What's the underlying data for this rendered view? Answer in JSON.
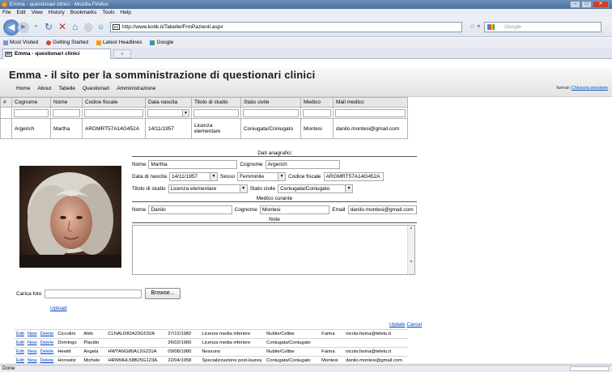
{
  "browser": {
    "window_title": "Emma - questionari clinici - Mozilla Firefox",
    "menu": [
      "File",
      "Edit",
      "View",
      "History",
      "Bookmarks",
      "Tools",
      "Help"
    ],
    "url": "http://www.kotik.it/Tabelle/FrmPazienti.aspx",
    "search_placeholder": "Google",
    "bookmarks": [
      "Most Visited",
      "Getting Started",
      "Latest Headlines",
      "Google"
    ],
    "tab_title": "Emma - questionari clinici",
    "status": "Done",
    "icons": [
      "back-arrow-icon",
      "forward-arrow-icon",
      "reload-icon",
      "stop-icon",
      "home-icon",
      "star-icon",
      "search-engine-icon"
    ]
  },
  "site": {
    "title": "Emma - il sito per la somministrazione di questionari clinici",
    "nav": [
      "Home",
      "About",
      "Tabelle",
      "Questionari",
      "Amministrazione"
    ],
    "user": "farinan",
    "logout": "Chiusura sessione"
  },
  "grid": {
    "columns": [
      "#",
      "Cognome",
      "Nome",
      "Codice fiscale",
      "Data nascita",
      "Titolo di studio",
      "Stato civile",
      "Medico",
      "Mail medico"
    ],
    "row": {
      "cognome": "Argerich",
      "nome": "Martha",
      "codice_fiscale": "ARGMRT57A14G452A",
      "data_nascita": "14/11/1957",
      "titolo_studio_1": "Licenza",
      "titolo_studio_2": "elementare",
      "stato_civile": "Coniugata/Coniugato",
      "medico": "Montesi",
      "mail_medico": "danilo.montesi@gmail.com"
    }
  },
  "detail": {
    "anagrafici_title": "Dati anagrafici",
    "labels": {
      "nome": "Nome",
      "cognome": "Cognome",
      "data_nascita": "Data di nascita",
      "sesso": "Sesso",
      "codice_fiscale": "Codice fiscale",
      "titolo_studio": "Titolo di studio",
      "stato_civile": "Stato civile",
      "email": "Email"
    },
    "values": {
      "nome": "Martha",
      "cognome": "Argerich",
      "data_nascita": "14/11/1957",
      "sesso": "Femminile",
      "codice_fiscale": "ARGMRT57A14G452A",
      "titolo_studio": "Licenza elementare",
      "stato_civile": "Coniugata/Coniugato"
    },
    "medico_title": "Medico curante",
    "medico": {
      "nome": "Danilo",
      "cognome": "Montesi",
      "email": "danilo.montesi@gmail.com"
    },
    "note_title": "Note",
    "carica_foto": "Carica foto",
    "browse": "Browse...",
    "upload": "Upload",
    "update": "Update",
    "cancel": "Cancel"
  },
  "list": {
    "action_labels": [
      "Edit",
      "New",
      "Delete"
    ],
    "rows": [
      [
        "Ciccolini",
        "Aldo",
        "CLNALD82A23G532A",
        "27/12/1982",
        "Licenza media inferiore",
        "Nubile/Celibe",
        "Farina",
        "nicola.farina@teletu.it"
      ],
      [
        "Domingo",
        "Placido",
        "",
        "26/02/1960",
        "Licenza media inferiore",
        "Coniugata/Coniugato",
        "",
        ""
      ],
      [
        "Hewitt",
        "Angela",
        "HWTANG80A12G231A",
        "09/08/1980",
        "Nessuno",
        "Nubile/Celibe",
        "Farina",
        "nicola.farina@teletu.it"
      ],
      [
        "Horowitz",
        "Michele",
        "HRWMHL58B25G123A",
        "22/04/1958",
        "Specializzazione post-laurea",
        "Coniugata/Coniugato",
        "Montesi",
        "danilo.montesi@gmail.com"
      ]
    ]
  }
}
